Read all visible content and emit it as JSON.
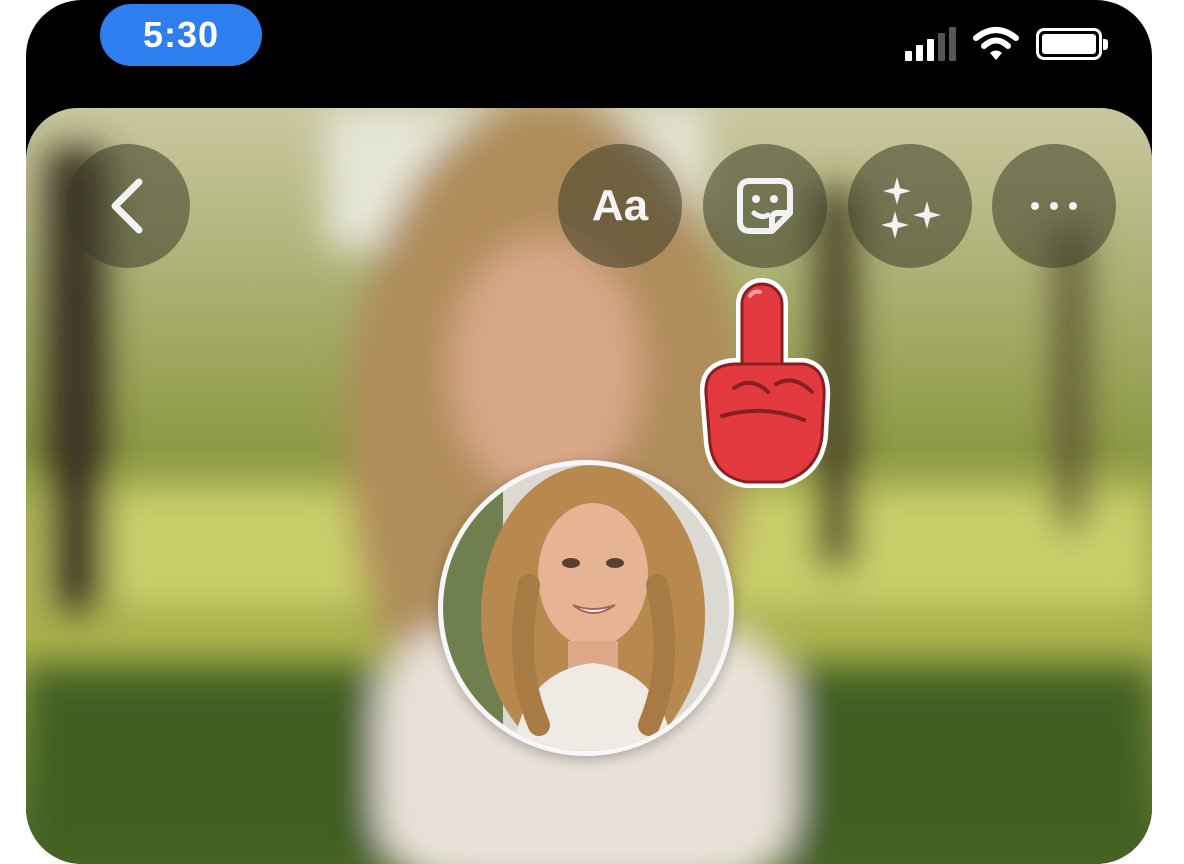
{
  "status_bar": {
    "time": "5:30",
    "signal_icon": "cellular-signal-icon",
    "wifi_icon": "wifi-icon",
    "battery_icon": "battery-icon",
    "time_pill_color": "#2f7ef0"
  },
  "toolbar": {
    "back_icon": "chevron-left-icon",
    "text_label": "Aa",
    "sticker_icon": "sticker-icon",
    "effects_icon": "sparkles-icon",
    "more_icon": "more-horizontal-icon"
  },
  "canvas": {
    "background": "blurred-park-portrait-photo",
    "sticker": "middle-finger-emoji-sticker",
    "sticker_color": "#e23a3f",
    "avatar": "round-portrait-photo"
  }
}
